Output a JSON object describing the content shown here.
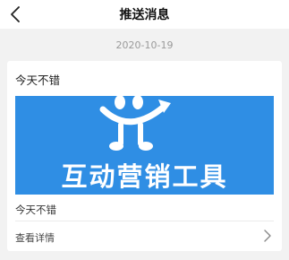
{
  "header": {
    "title": "推送消息",
    "back_icon": "chevron-left-icon"
  },
  "message": {
    "date": "2020-10-19",
    "title": "今天不错",
    "banner": {
      "text": "互动营销工具",
      "background": "#2f8ee4",
      "logo_icon": "smiley-arrow-logo"
    },
    "description": "今天不错",
    "detail_label": "查看详情",
    "detail_icon": "chevron-right-icon"
  }
}
